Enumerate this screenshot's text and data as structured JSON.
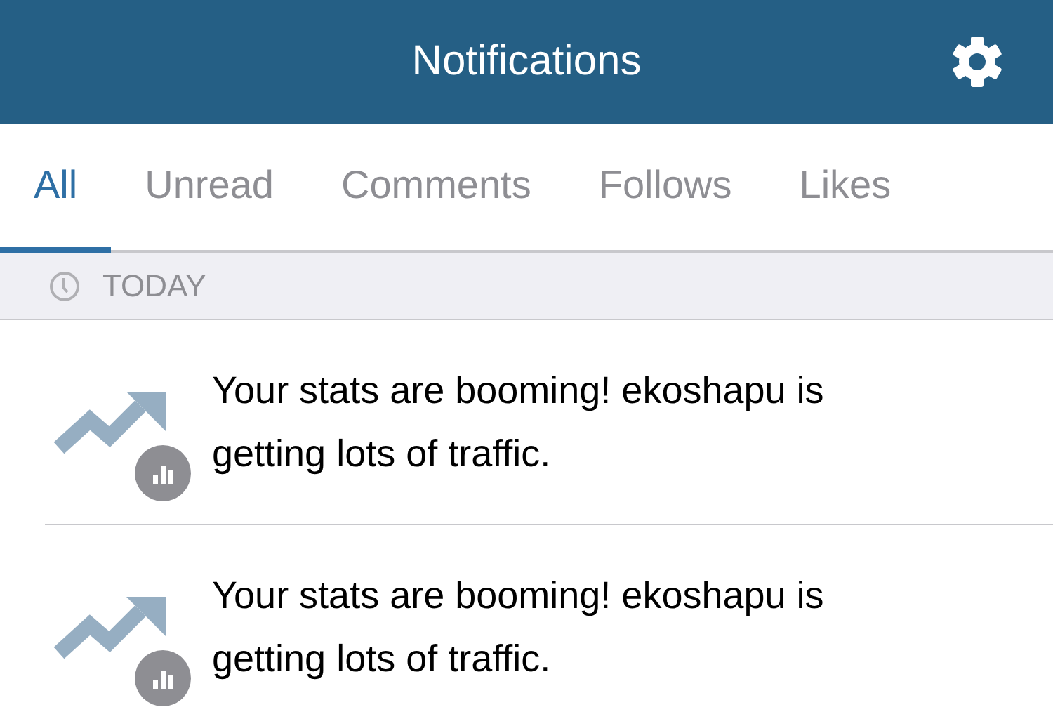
{
  "header": {
    "title": "Notifications"
  },
  "tabs": [
    {
      "label": "All",
      "selected": true
    },
    {
      "label": "Unread",
      "selected": false
    },
    {
      "label": "Comments",
      "selected": false
    },
    {
      "label": "Follows",
      "selected": false
    },
    {
      "label": "Likes",
      "selected": false
    }
  ],
  "section": {
    "label": "TODAY"
  },
  "notifications": [
    {
      "kind": "stats",
      "text": "Your stats are booming! ekoshapu is getting lots of traffic."
    },
    {
      "kind": "stats",
      "text": "Your stats are booming! ekoshapu is getting lots of traffic."
    }
  ]
}
